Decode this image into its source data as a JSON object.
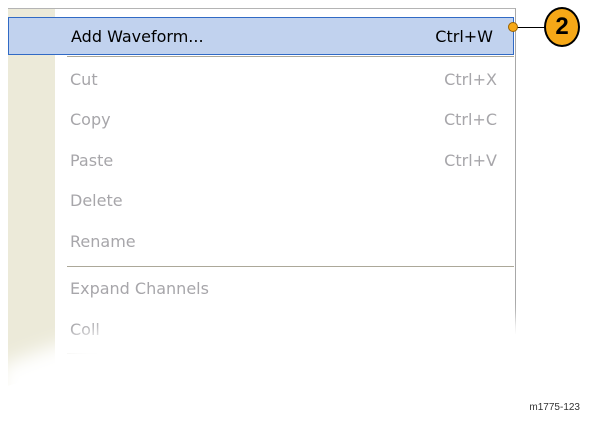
{
  "menu": {
    "items": [
      {
        "label": "Add Waveform...",
        "shortcut": "Ctrl+W"
      },
      {
        "label": "Cut",
        "shortcut": "Ctrl+X"
      },
      {
        "label": "Copy",
        "shortcut": "Ctrl+C"
      },
      {
        "label": "Paste",
        "shortcut": "Ctrl+V"
      },
      {
        "label": "Delete",
        "shortcut": ""
      },
      {
        "label": "Rename",
        "shortcut": ""
      },
      {
        "label": "Expand Channels",
        "shortcut": ""
      },
      {
        "label": "Coll",
        "shortcut": ""
      }
    ]
  },
  "callout": {
    "number": "2"
  },
  "figure_id": "m1775-123",
  "colors": {
    "highlight_bg": "#c1d2ee",
    "highlight_border": "#316ac5",
    "gutter": "#ecead9",
    "disabled_text": "#a7a6aa",
    "callout": "#f6a817"
  }
}
